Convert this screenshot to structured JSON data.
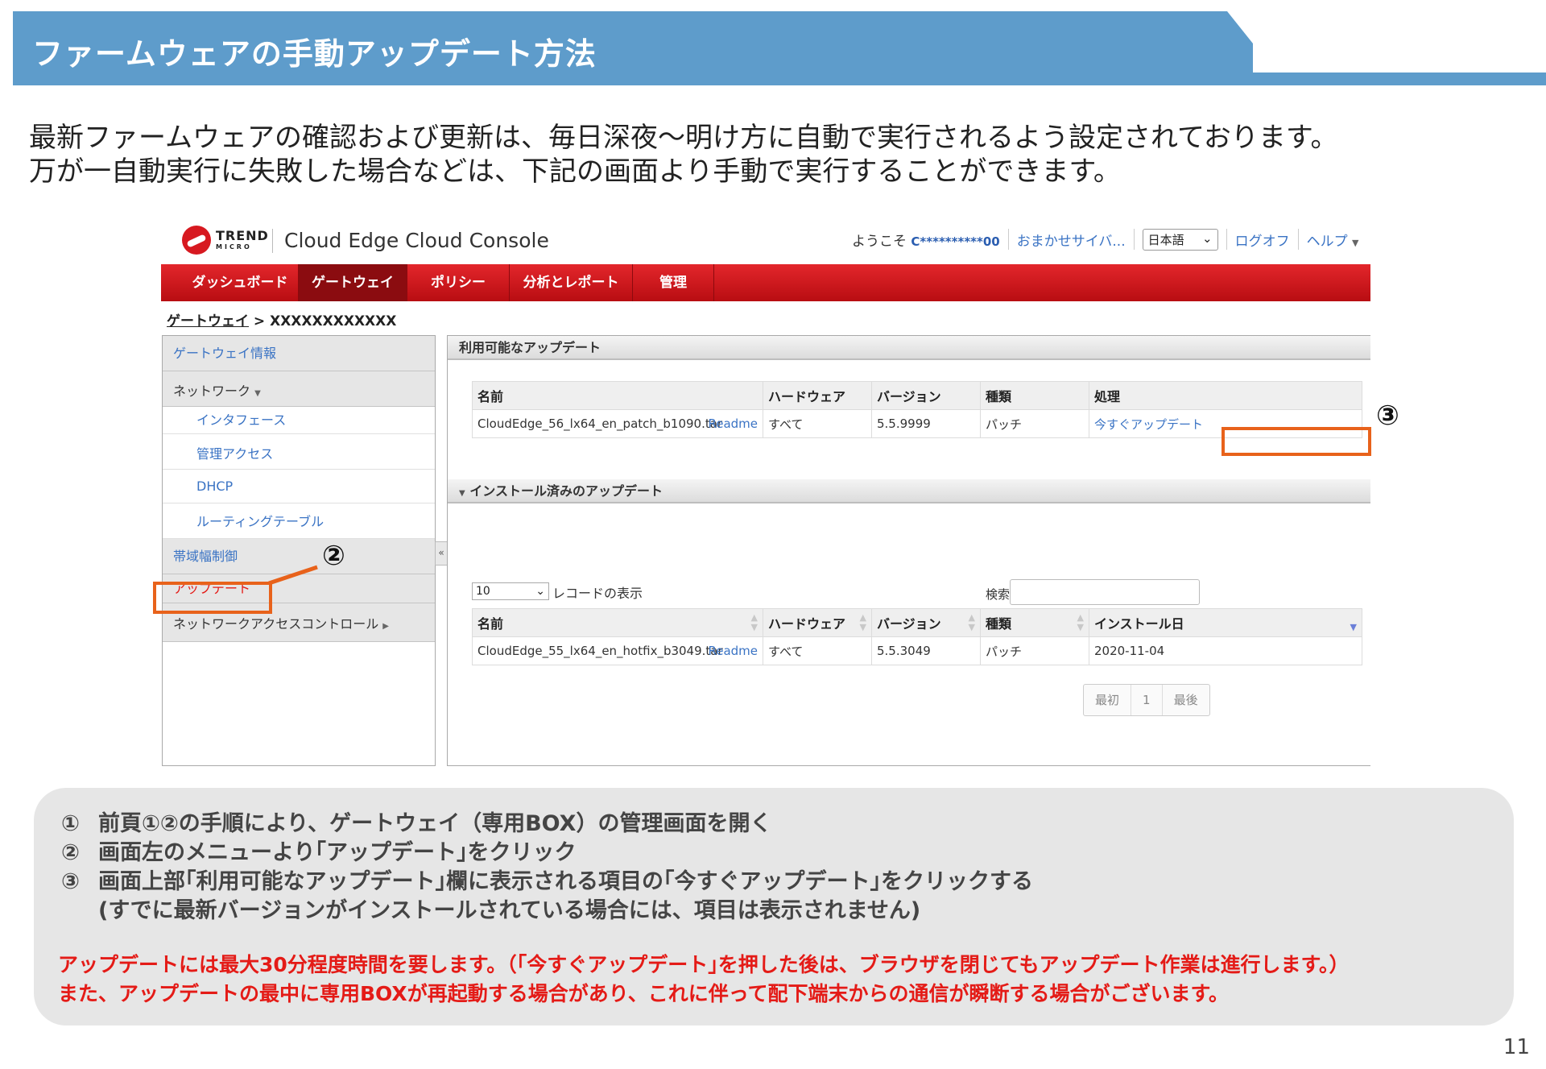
{
  "slide": {
    "title": "ファームウェアの手動アップデート方法",
    "intro_line1": "最新ファームウェアの確認および更新は、毎日深夜～明け方に自動で実行されるよう設定されております。",
    "intro_line2": "万が一自動実行に失敗した場合などは、下記の画面より手動で実行することができます。",
    "page_number": "11",
    "header_color": "#5e9ccb"
  },
  "console": {
    "logo_text": "TREND",
    "logo_subtext": "MICRO",
    "product_name": "Cloud Edge Cloud Console",
    "welcome_prefix": "ようこそ",
    "welcome_user": "C**********00",
    "company_link": "おまかせサイバ...",
    "language": "日本語",
    "logoff": "ログオフ",
    "help": "ヘルプ",
    "nav": [
      {
        "label": "ダッシュボード",
        "active": false
      },
      {
        "label": "ゲートウェイ",
        "active": true
      },
      {
        "label": "ポリシー",
        "active": false
      },
      {
        "label": "分析とレポート",
        "active": false
      },
      {
        "label": "管理",
        "active": false
      }
    ],
    "breadcrumb_link": "ゲートウェイ",
    "breadcrumb_sep": " > ",
    "breadcrumb_current": "XXXXXXXXXXXX",
    "sidebar": {
      "gateway_info": "ゲートウェイ情報",
      "network": "ネットワーク",
      "interface": "インタフェース",
      "mgmt_access": "管理アクセス",
      "dhcp": "DHCP",
      "routing_table": "ルーティングテーブル",
      "bandwidth_control": "帯域幅制御",
      "update": "アップデート",
      "nac": "ネットワークアクセスコントロール"
    },
    "available": {
      "title": "利用可能なアップデート",
      "headers": [
        "名前",
        "ハードウェア",
        "バージョン",
        "種類",
        "処理"
      ],
      "rows": [
        {
          "name": "CloudEdge_56_lx64_en_patch_b1090.tar",
          "readme": "Readme",
          "hardware": "すべて",
          "version": "5.5.9999",
          "type": "パッチ",
          "action": "今すぐアップデート"
        }
      ]
    },
    "installed": {
      "title": "インストール済みのアップデート",
      "records": "10",
      "records_label": "レコードの表示",
      "search_label": "検索",
      "headers": [
        "名前",
        "ハードウェア",
        "バージョン",
        "種類",
        "インストール日"
      ],
      "rows": [
        {
          "name": "CloudEdge_55_lx64_en_hotfix_b3049.tar",
          "readme": "Readme",
          "hardware": "すべて",
          "version": "5.5.3049",
          "type": "パッチ",
          "date": "2020-11-04"
        }
      ],
      "pager": {
        "first": "最初",
        "page": "1",
        "last": "最後"
      }
    }
  },
  "annotations": {
    "step2": "②",
    "step3": "③",
    "color": "#e8621b"
  },
  "notes": {
    "steps": [
      {
        "num": "①",
        "text": "前頁①②の手順により、ゲートウェイ（専用BOX）の管理画面を開く"
      },
      {
        "num": "②",
        "text": "画面左のメニューより｢アップデート｣をクリック"
      },
      {
        "num": "③",
        "text": "画面上部｢利用可能なアップデート｣欄に表示される項目の｢今すぐアップデート｣をクリックする"
      }
    ],
    "step3_sub": "(すでに最新バージョンがインストールされている場合には、項目は表示されません)",
    "warning1": "アップデートには最大30分程度時間を要します。（｢今すぐアップデート｣を押した後は、ブラウザを閉じてもアップデート作業は進行します。）",
    "warning2": "また、アップデートの最中に専用BOXが再起動する場合があり、これに伴って配下端末からの通信が瞬断する場合がございます。",
    "warning_color": "#e41b17"
  }
}
